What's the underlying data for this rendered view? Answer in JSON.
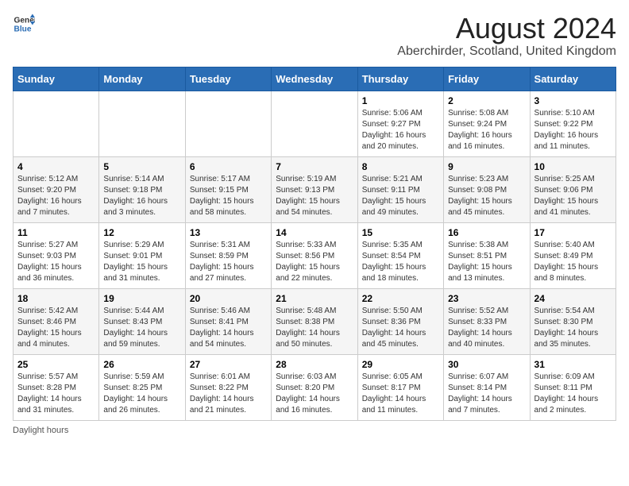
{
  "logo": {
    "general": "General",
    "blue": "Blue"
  },
  "title": "August 2024",
  "subtitle": "Aberchirder, Scotland, United Kingdom",
  "footer": "Daylight hours",
  "headers": [
    "Sunday",
    "Monday",
    "Tuesday",
    "Wednesday",
    "Thursday",
    "Friday",
    "Saturday"
  ],
  "weeks": [
    [
      {
        "day": "",
        "sunrise": "",
        "sunset": "",
        "daylight": ""
      },
      {
        "day": "",
        "sunrise": "",
        "sunset": "",
        "daylight": ""
      },
      {
        "day": "",
        "sunrise": "",
        "sunset": "",
        "daylight": ""
      },
      {
        "day": "",
        "sunrise": "",
        "sunset": "",
        "daylight": ""
      },
      {
        "day": "1",
        "sunrise": "Sunrise: 5:06 AM",
        "sunset": "Sunset: 9:27 PM",
        "daylight": "Daylight: 16 hours and 20 minutes."
      },
      {
        "day": "2",
        "sunrise": "Sunrise: 5:08 AM",
        "sunset": "Sunset: 9:24 PM",
        "daylight": "Daylight: 16 hours and 16 minutes."
      },
      {
        "day": "3",
        "sunrise": "Sunrise: 5:10 AM",
        "sunset": "Sunset: 9:22 PM",
        "daylight": "Daylight: 16 hours and 11 minutes."
      }
    ],
    [
      {
        "day": "4",
        "sunrise": "Sunrise: 5:12 AM",
        "sunset": "Sunset: 9:20 PM",
        "daylight": "Daylight: 16 hours and 7 minutes."
      },
      {
        "day": "5",
        "sunrise": "Sunrise: 5:14 AM",
        "sunset": "Sunset: 9:18 PM",
        "daylight": "Daylight: 16 hours and 3 minutes."
      },
      {
        "day": "6",
        "sunrise": "Sunrise: 5:17 AM",
        "sunset": "Sunset: 9:15 PM",
        "daylight": "Daylight: 15 hours and 58 minutes."
      },
      {
        "day": "7",
        "sunrise": "Sunrise: 5:19 AM",
        "sunset": "Sunset: 9:13 PM",
        "daylight": "Daylight: 15 hours and 54 minutes."
      },
      {
        "day": "8",
        "sunrise": "Sunrise: 5:21 AM",
        "sunset": "Sunset: 9:11 PM",
        "daylight": "Daylight: 15 hours and 49 minutes."
      },
      {
        "day": "9",
        "sunrise": "Sunrise: 5:23 AM",
        "sunset": "Sunset: 9:08 PM",
        "daylight": "Daylight: 15 hours and 45 minutes."
      },
      {
        "day": "10",
        "sunrise": "Sunrise: 5:25 AM",
        "sunset": "Sunset: 9:06 PM",
        "daylight": "Daylight: 15 hours and 41 minutes."
      }
    ],
    [
      {
        "day": "11",
        "sunrise": "Sunrise: 5:27 AM",
        "sunset": "Sunset: 9:03 PM",
        "daylight": "Daylight: 15 hours and 36 minutes."
      },
      {
        "day": "12",
        "sunrise": "Sunrise: 5:29 AM",
        "sunset": "Sunset: 9:01 PM",
        "daylight": "Daylight: 15 hours and 31 minutes."
      },
      {
        "day": "13",
        "sunrise": "Sunrise: 5:31 AM",
        "sunset": "Sunset: 8:59 PM",
        "daylight": "Daylight: 15 hours and 27 minutes."
      },
      {
        "day": "14",
        "sunrise": "Sunrise: 5:33 AM",
        "sunset": "Sunset: 8:56 PM",
        "daylight": "Daylight: 15 hours and 22 minutes."
      },
      {
        "day": "15",
        "sunrise": "Sunrise: 5:35 AM",
        "sunset": "Sunset: 8:54 PM",
        "daylight": "Daylight: 15 hours and 18 minutes."
      },
      {
        "day": "16",
        "sunrise": "Sunrise: 5:38 AM",
        "sunset": "Sunset: 8:51 PM",
        "daylight": "Daylight: 15 hours and 13 minutes."
      },
      {
        "day": "17",
        "sunrise": "Sunrise: 5:40 AM",
        "sunset": "Sunset: 8:49 PM",
        "daylight": "Daylight: 15 hours and 8 minutes."
      }
    ],
    [
      {
        "day": "18",
        "sunrise": "Sunrise: 5:42 AM",
        "sunset": "Sunset: 8:46 PM",
        "daylight": "Daylight: 15 hours and 4 minutes."
      },
      {
        "day": "19",
        "sunrise": "Sunrise: 5:44 AM",
        "sunset": "Sunset: 8:43 PM",
        "daylight": "Daylight: 14 hours and 59 minutes."
      },
      {
        "day": "20",
        "sunrise": "Sunrise: 5:46 AM",
        "sunset": "Sunset: 8:41 PM",
        "daylight": "Daylight: 14 hours and 54 minutes."
      },
      {
        "day": "21",
        "sunrise": "Sunrise: 5:48 AM",
        "sunset": "Sunset: 8:38 PM",
        "daylight": "Daylight: 14 hours and 50 minutes."
      },
      {
        "day": "22",
        "sunrise": "Sunrise: 5:50 AM",
        "sunset": "Sunset: 8:36 PM",
        "daylight": "Daylight: 14 hours and 45 minutes."
      },
      {
        "day": "23",
        "sunrise": "Sunrise: 5:52 AM",
        "sunset": "Sunset: 8:33 PM",
        "daylight": "Daylight: 14 hours and 40 minutes."
      },
      {
        "day": "24",
        "sunrise": "Sunrise: 5:54 AM",
        "sunset": "Sunset: 8:30 PM",
        "daylight": "Daylight: 14 hours and 35 minutes."
      }
    ],
    [
      {
        "day": "25",
        "sunrise": "Sunrise: 5:57 AM",
        "sunset": "Sunset: 8:28 PM",
        "daylight": "Daylight: 14 hours and 31 minutes."
      },
      {
        "day": "26",
        "sunrise": "Sunrise: 5:59 AM",
        "sunset": "Sunset: 8:25 PM",
        "daylight": "Daylight: 14 hours and 26 minutes."
      },
      {
        "day": "27",
        "sunrise": "Sunrise: 6:01 AM",
        "sunset": "Sunset: 8:22 PM",
        "daylight": "Daylight: 14 hours and 21 minutes."
      },
      {
        "day": "28",
        "sunrise": "Sunrise: 6:03 AM",
        "sunset": "Sunset: 8:20 PM",
        "daylight": "Daylight: 14 hours and 16 minutes."
      },
      {
        "day": "29",
        "sunrise": "Sunrise: 6:05 AM",
        "sunset": "Sunset: 8:17 PM",
        "daylight": "Daylight: 14 hours and 11 minutes."
      },
      {
        "day": "30",
        "sunrise": "Sunrise: 6:07 AM",
        "sunset": "Sunset: 8:14 PM",
        "daylight": "Daylight: 14 hours and 7 minutes."
      },
      {
        "day": "31",
        "sunrise": "Sunrise: 6:09 AM",
        "sunset": "Sunset: 8:11 PM",
        "daylight": "Daylight: 14 hours and 2 minutes."
      }
    ]
  ]
}
